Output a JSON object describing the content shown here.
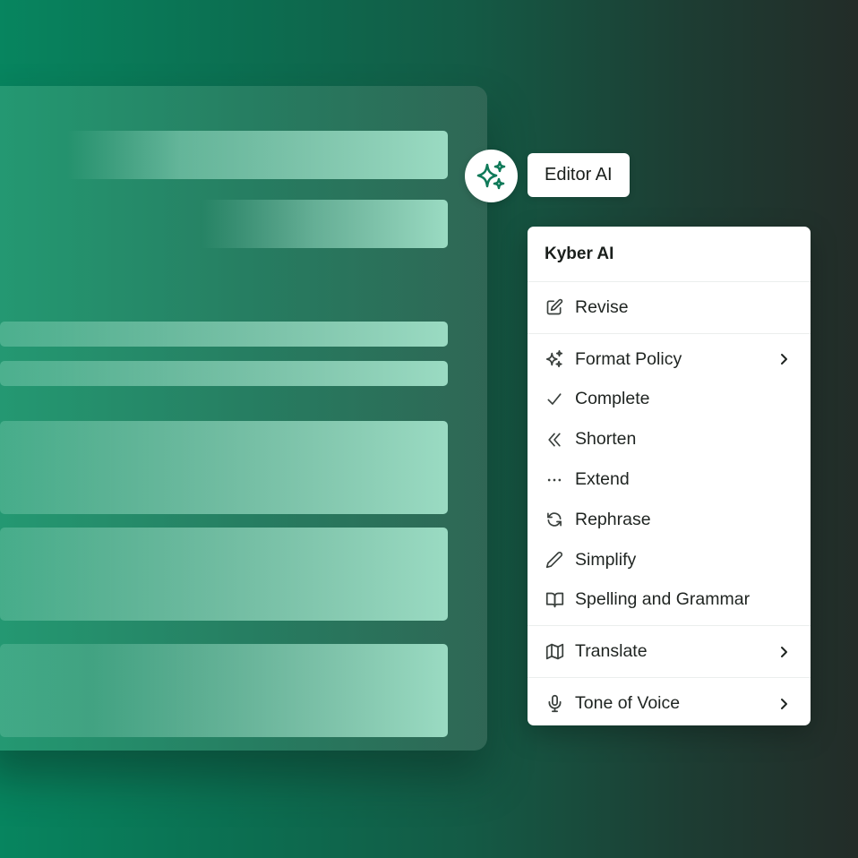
{
  "trigger": {
    "icon": "sparkles-icon",
    "label": "Editor AI",
    "icon_color": "#0f7a59"
  },
  "menu": {
    "title": "Kyber AI",
    "groups": [
      {
        "items": [
          {
            "label": "Revise",
            "icon": "edit-icon"
          }
        ]
      },
      {
        "items": [
          {
            "label": "Format Policy",
            "icon": "sparkles-icon",
            "submenu": true
          },
          {
            "label": "Complete",
            "icon": "check-icon"
          },
          {
            "label": "Shorten",
            "icon": "chevrons-left-icon"
          },
          {
            "label": "Extend",
            "icon": "ellipsis-icon"
          },
          {
            "label": "Rephrase",
            "icon": "refresh-icon"
          },
          {
            "label": "Simplify",
            "icon": "pencil-icon"
          },
          {
            "label": "Spelling and Grammar",
            "icon": "book-icon"
          }
        ]
      },
      {
        "items": [
          {
            "label": "Translate",
            "icon": "map-icon",
            "submenu": true
          }
        ]
      },
      {
        "items": [
          {
            "label": "Tone of Voice",
            "icon": "microphone-icon",
            "submenu": true
          }
        ]
      }
    ]
  }
}
